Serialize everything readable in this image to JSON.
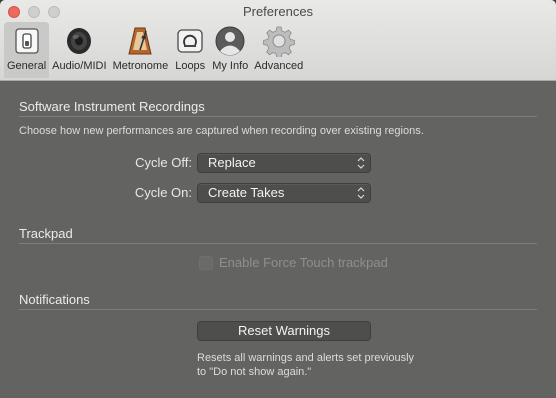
{
  "window": {
    "title": "Preferences"
  },
  "toolbar": {
    "tabs": [
      {
        "label": "General",
        "icon": "switch-icon",
        "selected": true
      },
      {
        "label": "Audio/MIDI",
        "icon": "speaker-icon",
        "selected": false
      },
      {
        "label": "Metronome",
        "icon": "metronome-icon",
        "selected": false
      },
      {
        "label": "Loops",
        "icon": "loop-icon",
        "selected": false
      },
      {
        "label": "My Info",
        "icon": "person-icon",
        "selected": false
      },
      {
        "label": "Advanced",
        "icon": "gear-icon",
        "selected": false
      }
    ]
  },
  "recordings": {
    "title": "Software Instrument Recordings",
    "description": "Choose how new performances are captured when recording over existing regions.",
    "cycle_off_label": "Cycle Off:",
    "cycle_off_value": "Replace",
    "cycle_on_label": "Cycle On:",
    "cycle_on_value": "Create Takes"
  },
  "trackpad": {
    "title": "Trackpad",
    "force_touch_label": "Enable Force Touch trackpad",
    "force_touch_checked": false,
    "force_touch_enabled": false
  },
  "notifications": {
    "title": "Notifications",
    "reset_button": "Reset Warnings",
    "note_line1": "Resets all warnings and alerts set previously",
    "note_line2": "to \"Do not show again.\""
  },
  "colors": {
    "close_button": "#ed6a5e",
    "panel_background": "#636361",
    "toolbar_background": "#e0e0df"
  }
}
